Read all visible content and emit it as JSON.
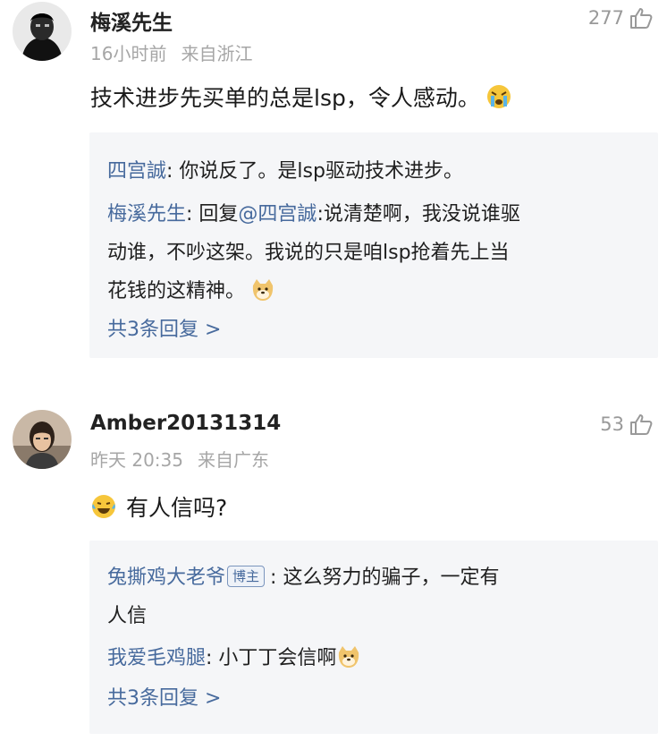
{
  "comments": [
    {
      "username": "梅溪先生",
      "time": "16小时前",
      "location": "来自浙江",
      "likes": "277",
      "text": "技术进步先买单的总是lsp，令人感动。",
      "text_emoji": "crying-face-emoji",
      "replies": [
        {
          "name": "四宫誠",
          "sep": ": ",
          "text": "你说反了。是lsp驱动技术进步。"
        },
        {
          "name": "梅溪先生",
          "sep": ": 回复",
          "mention": "@四宫誠",
          "text_line1": ":说清楚啊，我没说谁驱",
          "text_line2": "动谁，不吵这架。我说的只是咱lsp抢着先上当",
          "text_line3": "花钱的这精神。",
          "emoji": "doge-emoji"
        }
      ],
      "more": "共3条回复 >"
    },
    {
      "username": "Amber20131314",
      "time": "昨天 20:35",
      "location": "来自广东",
      "likes": "53",
      "text": "有人信吗?",
      "text_emoji": "laughing-tears-emoji",
      "replies": [
        {
          "name": "兔撕鸡大老爷",
          "badge": "博主",
          "sep": ": ",
          "text_line1": "这么努力的骗子，一定有",
          "text_line2": "人信"
        },
        {
          "name": "我爱毛鸡腿",
          "sep": ": ",
          "text": "小丁丁会信啊",
          "emoji": "doge-emoji"
        }
      ],
      "more": "共3条回复 >"
    }
  ],
  "colors": {
    "link_blue": "#476a9d",
    "meta_gray": "#a6a6a6",
    "reply_bg": "#f5f6f8"
  }
}
